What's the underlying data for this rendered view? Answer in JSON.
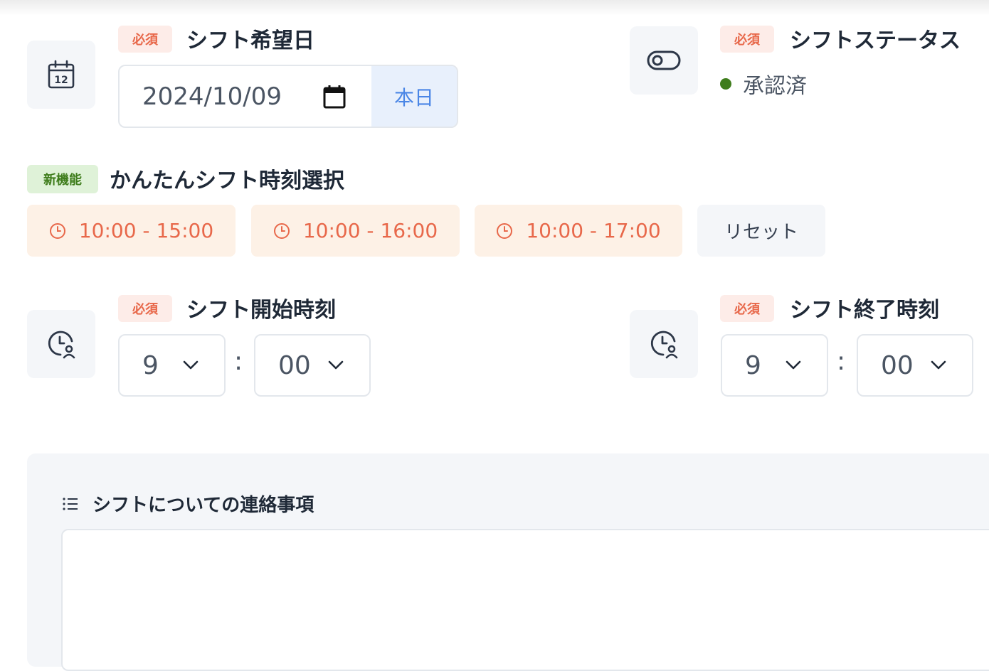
{
  "badges": {
    "required": "必須",
    "new_feature": "新機能"
  },
  "shift_date": {
    "title": "シフト希望日",
    "value": "2024/10/09",
    "today_button": "本日"
  },
  "shift_status": {
    "title": "シフトステータス",
    "value": "承認済",
    "dot_color": "#3f7d1c"
  },
  "quick_select": {
    "title": "かんたんシフト時刻選択",
    "presets": [
      "10:00 - 15:00",
      "10:00 - 16:00",
      "10:00 - 17:00"
    ],
    "reset_label": "リセット"
  },
  "start_time": {
    "title": "シフト開始時刻",
    "hour": "9",
    "minute": "00",
    "separator": ":"
  },
  "end_time": {
    "title": "シフト終了時刻",
    "hour": "9",
    "minute": "00",
    "separator": ":"
  },
  "notes": {
    "title": "シフトについての連絡事項",
    "value": ""
  },
  "colors": {
    "required_badge_bg": "#fdece8",
    "required_badge_text": "#e8684a",
    "new_badge_bg": "#dff2d8",
    "new_badge_text": "#3f7d1c",
    "preset_bg": "#fdf1e6",
    "preset_text": "#e8684a",
    "today_bg": "#e8f0fc",
    "today_text": "#4a86e6"
  },
  "icons": {
    "date": "calendar-icon",
    "status": "toggle-icon",
    "start": "clock-user-icon",
    "end": "clock-user-icon",
    "preset": "clock-icon",
    "notes": "list-icon",
    "dropdown": "chevron-down-icon"
  }
}
